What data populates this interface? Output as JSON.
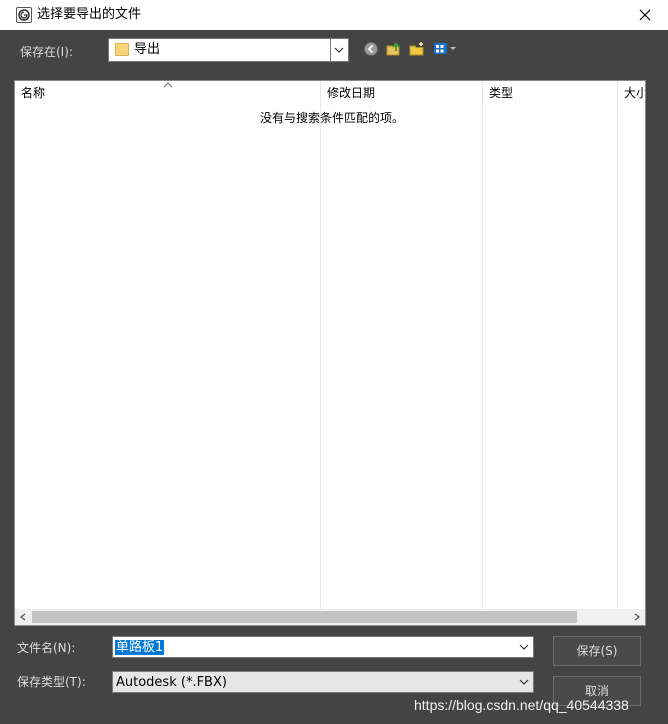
{
  "window": {
    "title": "选择要导出的文件",
    "icon": "3dsmax-app-icon",
    "close_icon": "close-icon"
  },
  "save_in": {
    "label": "保存在(I):",
    "folder": "导出"
  },
  "toolbar": {
    "icons": [
      "back-icon",
      "up-folder-icon",
      "new-folder-icon",
      "view-menu-icon"
    ]
  },
  "file_list": {
    "columns": [
      "名称",
      "修改日期",
      "类型",
      "大小"
    ],
    "empty_message": "没有与搜索条件匹配的项。",
    "rows": []
  },
  "file_name": {
    "label": "文件名(N):",
    "value": "单路板1"
  },
  "save_type": {
    "label": "保存类型(T):",
    "value": "Autodesk (*.FBX)"
  },
  "buttons": {
    "save": "保存(S)",
    "cancel": "取消"
  },
  "watermark": "https://blog.csdn.net/qq_40544338",
  "colors": {
    "dialog_bg": "#444444",
    "selection": "#0078d7",
    "folder": "#f6d57a"
  }
}
